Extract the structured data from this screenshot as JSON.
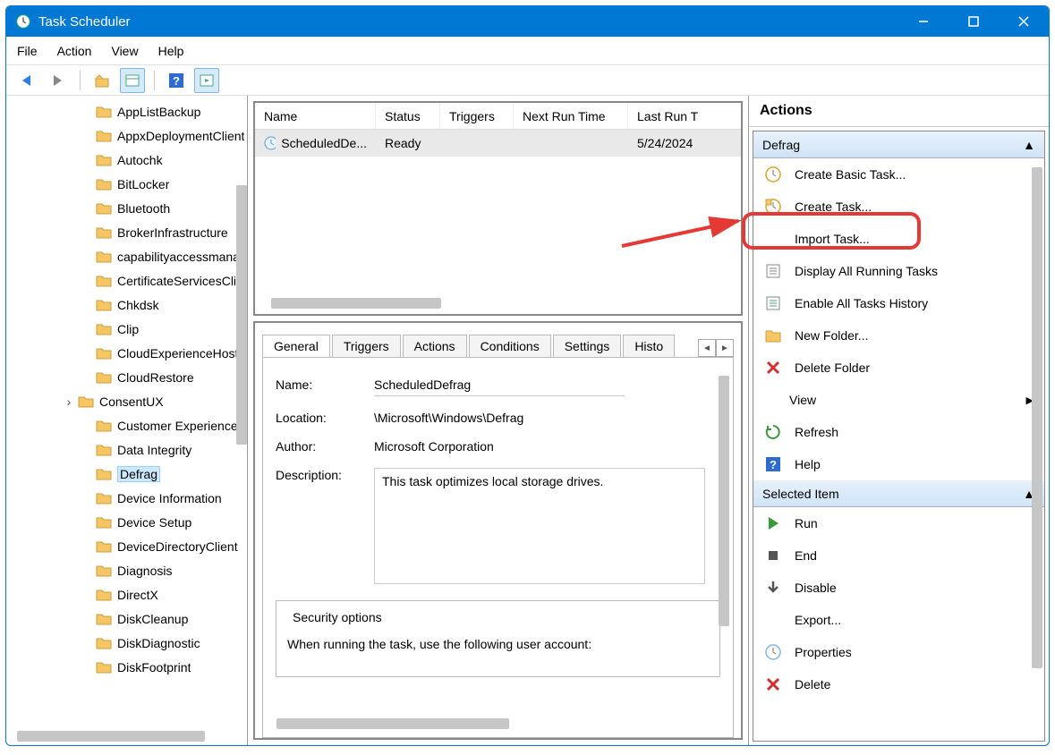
{
  "window": {
    "title": "Task Scheduler"
  },
  "menubar": [
    "File",
    "Action",
    "View",
    "Help"
  ],
  "nav": {
    "items": [
      {
        "label": "AppListBackup"
      },
      {
        "label": "AppxDeploymentClient"
      },
      {
        "label": "Autochk"
      },
      {
        "label": "BitLocker"
      },
      {
        "label": "Bluetooth"
      },
      {
        "label": "BrokerInfrastructure"
      },
      {
        "label": "capabilityaccessmanager"
      },
      {
        "label": "CertificateServicesClient"
      },
      {
        "label": "Chkdsk"
      },
      {
        "label": "Clip"
      },
      {
        "label": "CloudExperienceHost"
      },
      {
        "label": "CloudRestore"
      },
      {
        "label": "ConsentUX",
        "expandable": true
      },
      {
        "label": "Customer Experience"
      },
      {
        "label": "Data Integrity"
      },
      {
        "label": "Defrag",
        "selected": true
      },
      {
        "label": "Device Information"
      },
      {
        "label": "Device Setup"
      },
      {
        "label": "DeviceDirectoryClient"
      },
      {
        "label": "Diagnosis"
      },
      {
        "label": "DirectX"
      },
      {
        "label": "DiskCleanup"
      },
      {
        "label": "DiskDiagnostic"
      },
      {
        "label": "DiskFootprint"
      }
    ]
  },
  "tasklist": {
    "columns": [
      "Name",
      "Status",
      "Triggers",
      "Next Run Time",
      "Last Run Time"
    ],
    "rows": [
      {
        "name": "ScheduledDe...",
        "status": "Ready",
        "triggers": "",
        "next": "",
        "last": "5/24/2024"
      }
    ]
  },
  "details": {
    "tabs": [
      "General",
      "Triggers",
      "Actions",
      "Conditions",
      "Settings",
      "History"
    ],
    "name_label": "Name:",
    "name": "ScheduledDefrag",
    "location_label": "Location:",
    "location": "\\Microsoft\\Windows\\Defrag",
    "author_label": "Author:",
    "author": "Microsoft Corporation",
    "description_label": "Description:",
    "description": "This task optimizes local storage drives.",
    "security_legend": "Security options",
    "security_text": "When running the task, use the following user account:"
  },
  "actions": {
    "header": "Actions",
    "section1": "Defrag",
    "items1": [
      {
        "label": "Create Basic Task...",
        "icon": "clock"
      },
      {
        "label": "Create Task...",
        "icon": "clock2",
        "hl": true
      },
      {
        "label": "Import Task...",
        "icon": "blank"
      },
      {
        "label": "Display All Running Tasks",
        "icon": "list"
      },
      {
        "label": "Enable All Tasks History",
        "icon": "list2"
      },
      {
        "label": "New Folder...",
        "icon": "folder"
      },
      {
        "label": "Delete Folder",
        "icon": "x"
      },
      {
        "label": "View",
        "icon": "blank",
        "submenu": true
      },
      {
        "label": "Refresh",
        "icon": "refresh"
      },
      {
        "label": "Help",
        "icon": "help"
      }
    ],
    "section2": "Selected Item",
    "items2": [
      {
        "label": "Run",
        "icon": "play"
      },
      {
        "label": "End",
        "icon": "stop"
      },
      {
        "label": "Disable",
        "icon": "down"
      },
      {
        "label": "Export...",
        "icon": "blank"
      },
      {
        "label": "Properties",
        "icon": "clock3"
      },
      {
        "label": "Delete",
        "icon": "x"
      }
    ]
  }
}
